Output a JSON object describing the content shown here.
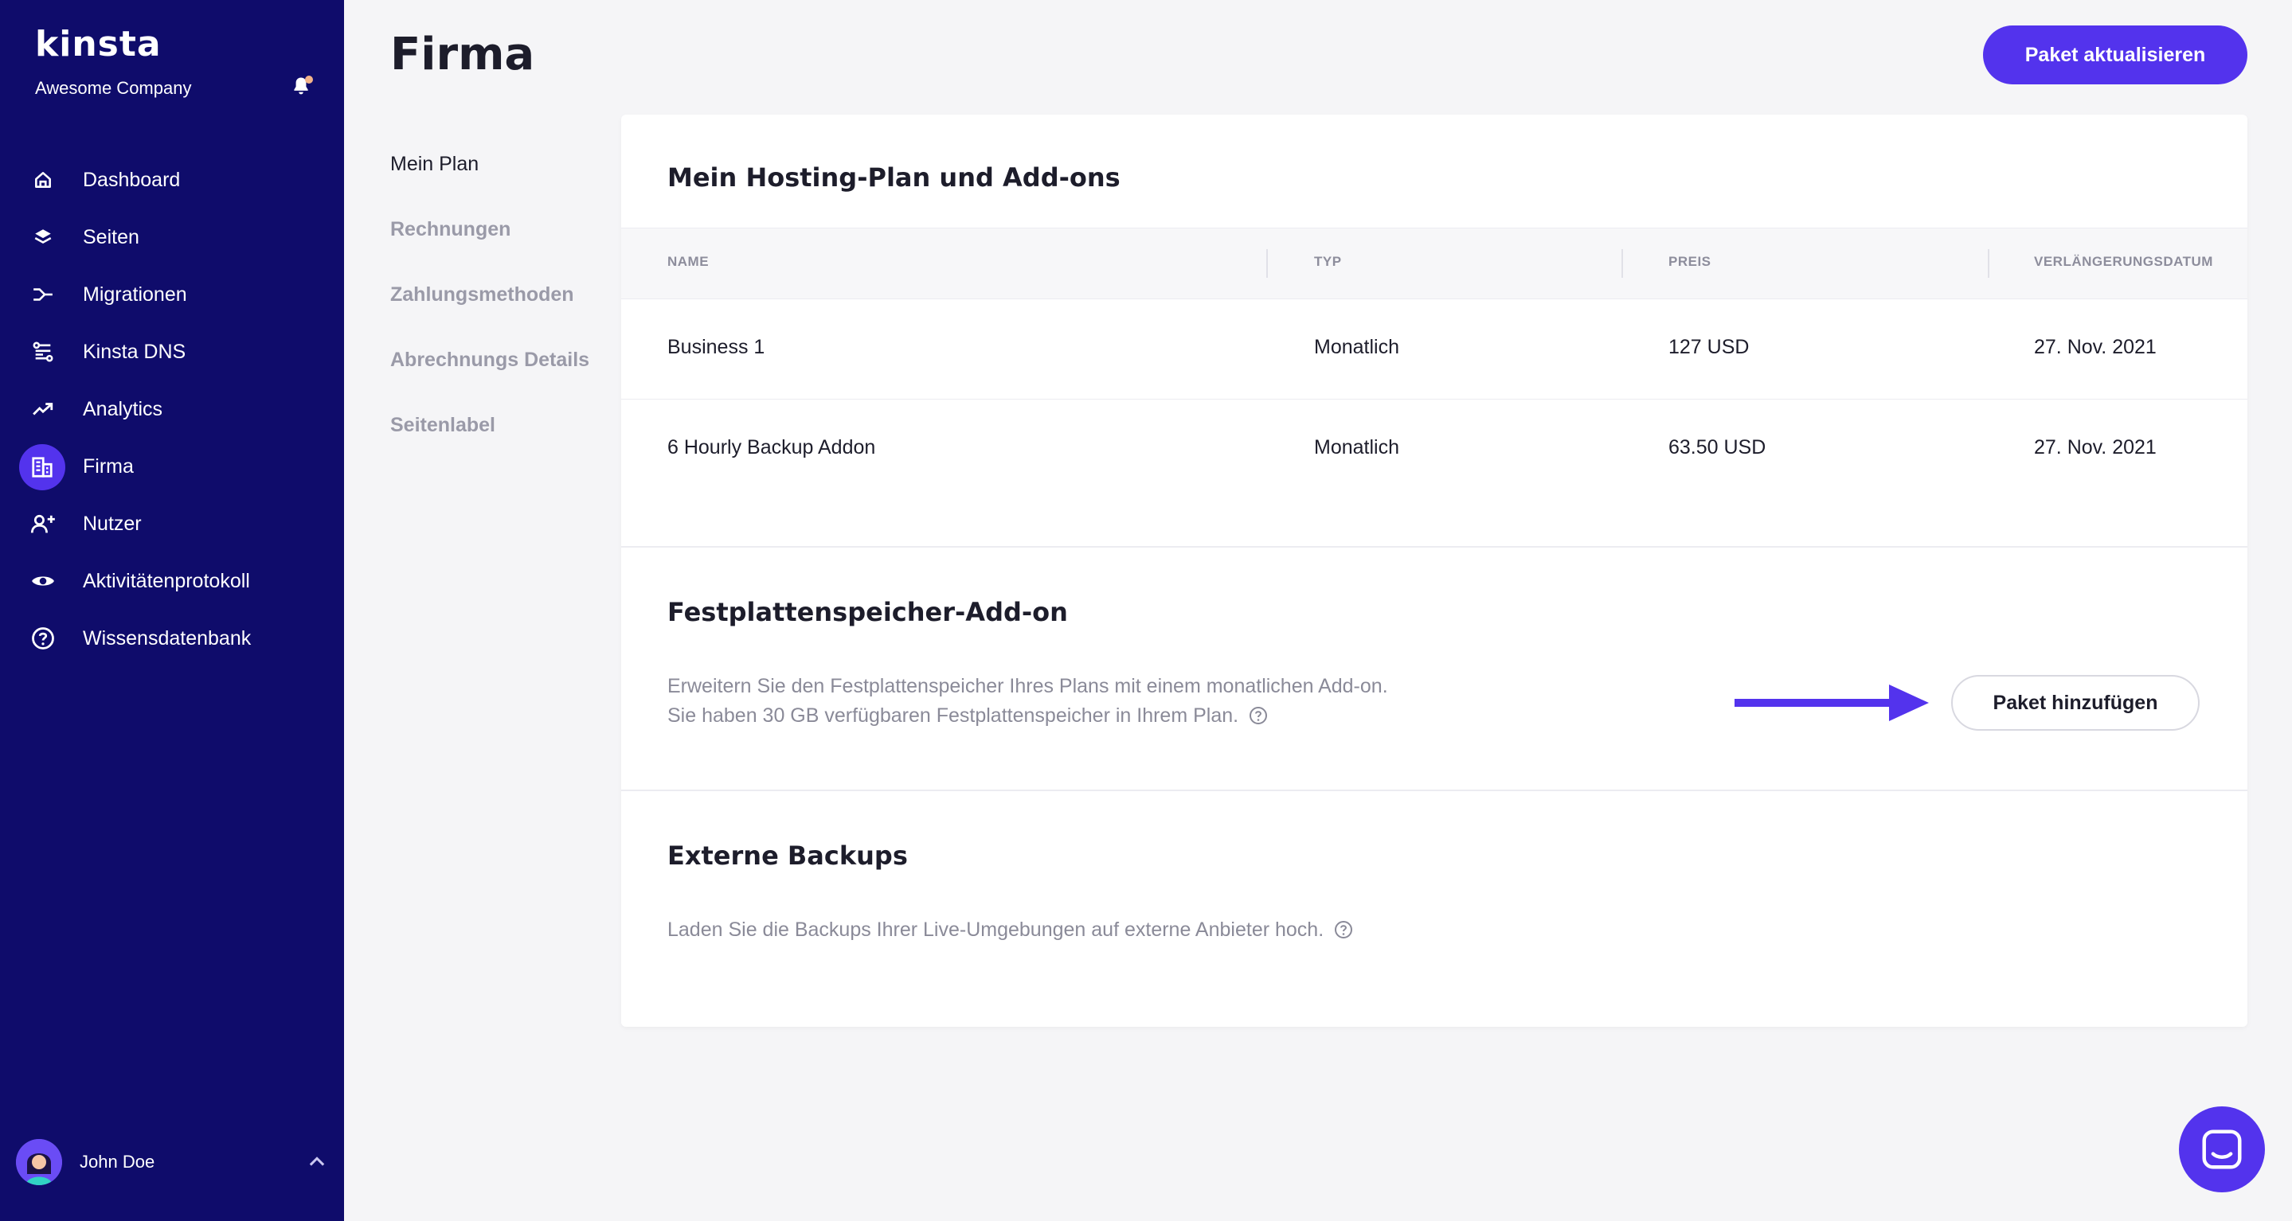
{
  "brand": {
    "logo_text": "kinsta",
    "company": "Awesome Company"
  },
  "sidebar": {
    "items": [
      {
        "label": "Dashboard",
        "icon": "home-icon"
      },
      {
        "label": "Seiten",
        "icon": "layers-icon"
      },
      {
        "label": "Migrationen",
        "icon": "migration-icon"
      },
      {
        "label": "Kinsta DNS",
        "icon": "dns-icon"
      },
      {
        "label": "Analytics",
        "icon": "trend-icon"
      },
      {
        "label": "Firma",
        "icon": "building-icon",
        "active": true
      },
      {
        "label": "Nutzer",
        "icon": "user-add-icon"
      },
      {
        "label": "Aktivitätenprotokoll",
        "icon": "eye-icon"
      },
      {
        "label": "Wissensdatenbank",
        "icon": "help-circle-icon"
      }
    ],
    "user": {
      "name": "John Doe"
    }
  },
  "header": {
    "title": "Firma",
    "upgrade_button": "Paket aktualisieren"
  },
  "subnav": {
    "items": [
      {
        "label": "Mein Plan",
        "active": true
      },
      {
        "label": "Rechnungen"
      },
      {
        "label": "Zahlungsmethoden"
      },
      {
        "label": "Abrechnungs Details"
      },
      {
        "label": "Seitenlabel"
      }
    ]
  },
  "plan": {
    "title": "Mein Hosting-Plan und Add-ons",
    "columns": [
      "NAME",
      "TYP",
      "PREIS",
      "VERLÄNGERUNGSDATUM"
    ],
    "rows": [
      {
        "name": "Business 1",
        "type": "Monatlich",
        "price": "127 USD",
        "renewal": "27. Nov. 2021"
      },
      {
        "name": "6 Hourly Backup Addon",
        "type": "Monatlich",
        "price": "63.50 USD",
        "renewal": "27. Nov. 2021"
      }
    ]
  },
  "storage": {
    "title": "Festplattenspeicher-Add-on",
    "line1": "Erweitern Sie den Festplattenspeicher Ihres Plans mit einem monatlichen Add-on.",
    "line2": "Sie haben 30 GB verfügbaren Festplattenspeicher in Ihrem Plan.",
    "button": "Paket hinzufügen"
  },
  "backups": {
    "title": "Externe Backups",
    "text": "Laden Sie die Backups Ihrer Live-Umgebungen auf externe Anbieter hoch."
  },
  "colors": {
    "sidebar_bg": "#0f0c6b",
    "accent": "#5333ed"
  }
}
